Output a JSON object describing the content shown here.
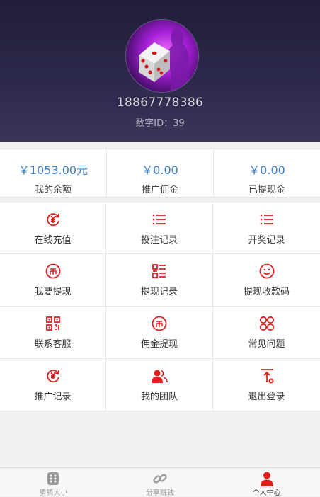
{
  "profile": {
    "phone": "18867778386",
    "id_label": "数字ID：",
    "id_value": "39"
  },
  "stats": [
    {
      "value": "￥1053.00元",
      "label": "我的余额"
    },
    {
      "value": "￥0.00",
      "label": "推广佣金"
    },
    {
      "value": "￥0.00",
      "label": "已提现金"
    }
  ],
  "menu": [
    {
      "label": "在线充值",
      "icon": "yen-refresh-icon"
    },
    {
      "label": "投注记录",
      "icon": "list-icon"
    },
    {
      "label": "开奖记录",
      "icon": "list-icon"
    },
    {
      "label": "我要提现",
      "icon": "coin-icon"
    },
    {
      "label": "提现记录",
      "icon": "grid-list-icon"
    },
    {
      "label": "提现收款码",
      "icon": "smile-icon"
    },
    {
      "label": "联系客服",
      "icon": "qr-code-icon"
    },
    {
      "label": "佣金提现",
      "icon": "coin-icon"
    },
    {
      "label": "常见问题",
      "icon": "four-circles-icon"
    },
    {
      "label": "推广记录",
      "icon": "yen-refresh-icon"
    },
    {
      "label": "我的团队",
      "icon": "team-icon"
    },
    {
      "label": "退出登录",
      "icon": "logout-icon"
    }
  ],
  "tabs": [
    {
      "label": "猜猜大小",
      "icon": "dice-icon"
    },
    {
      "label": "分享赚钱",
      "icon": "link-icon"
    },
    {
      "label": "个人中心",
      "icon": "person-icon"
    }
  ],
  "colors": {
    "accent_red": "#e02020",
    "value_blue": "#3b7fc4",
    "header_dark": "#211e3c"
  }
}
